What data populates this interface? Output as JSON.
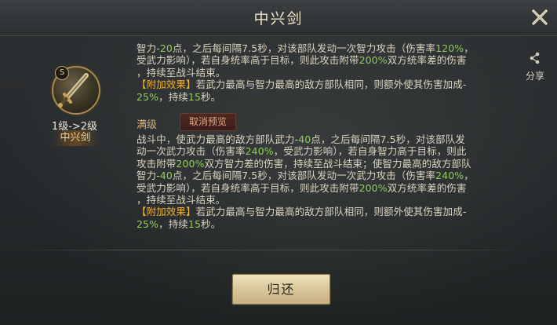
{
  "header": {
    "title": "中兴剑"
  },
  "share": {
    "label": "分享"
  },
  "item": {
    "badge": "S",
    "level_change": "1级->2级",
    "name": "中兴剑"
  },
  "current": {
    "line1": {
      "t1": "智力-",
      "n1": "20",
      "t2": "点，之后每间隔7.5秒，对该部队发动一次智力攻击（伤害率",
      "n2": "120%",
      "t3": "，"
    },
    "line2": {
      "t1": "受武力影响），若自身统率高于目标，则此攻击附带",
      "n1": "200%",
      "t2": "双方统率差的伤害"
    },
    "line3": {
      "t1": "，持续至战斗结束。"
    },
    "line4": {
      "b": "【附加效果】",
      "t1": "若武力最高与智力最高的敌方部队相同，则额外使其伤害加成-"
    },
    "line5": {
      "n1": "25%",
      "t1": "，持续",
      "n2": "15",
      "t2": "秒。"
    }
  },
  "max_level_label": "满级",
  "cancel_preview_label": "取消预览",
  "next": {
    "line1": {
      "t1": "战斗中，使武力最高的敌方部队武力-",
      "n1": "40",
      "t2": "点，之后每间隔7.5秒，对该部队发"
    },
    "line2": {
      "t1": "动一次武力攻击（伤害率",
      "n1": "240%",
      "t2": "，受武力影响），若自身智力高于目标，则此"
    },
    "line3": {
      "t1": "攻击附带",
      "n1": "200%",
      "t2": "双方智力差的伤害，持续至战斗结束；使智力最高的敌方部队"
    },
    "line4": {
      "t1": "智力-",
      "n1": "40",
      "t2": "点，之后每间隔7.5秒，对该部队发动一次武力攻击（伤害率",
      "n2": "240%",
      "t3": "，"
    },
    "line5": {
      "t1": "受武力影响），若自身统率高于目标，则此攻击附带",
      "n1": "200%",
      "t2": "双方统率差的伤害"
    },
    "line6": {
      "t1": "，持续至战斗结束。"
    },
    "line7": {
      "b": "【附加效果】",
      "t1": "若武力最高与智力最高的敌方部队相同，则额外使其伤害加成-"
    },
    "line8": {
      "n1": "25%",
      "t1": "，持续",
      "n2": "15",
      "t2": "秒。"
    }
  },
  "return_label": "归还",
  "colors": {
    "number": "#8fce57",
    "bonus": "#f0b030",
    "accent": "#d9c79a"
  }
}
